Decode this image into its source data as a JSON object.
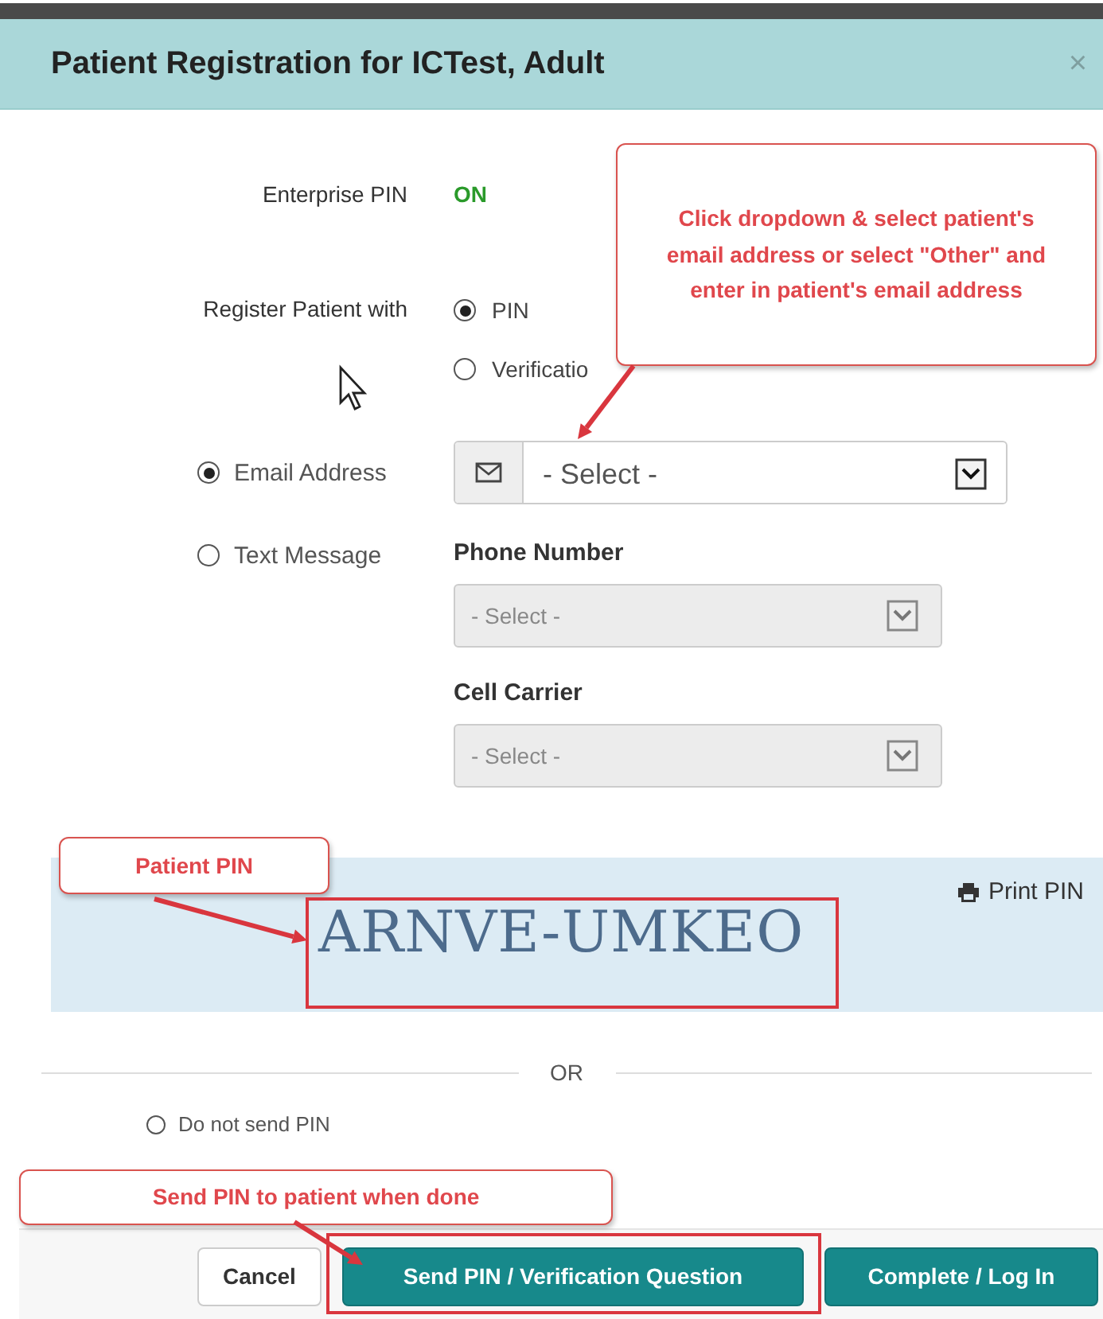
{
  "dialog": {
    "title": "Patient Registration for ICTest, Adult",
    "close": "×"
  },
  "enterprise_pin": {
    "label": "Enterprise PIN",
    "value": "ON"
  },
  "register_with": {
    "label": "Register Patient with",
    "options": [
      {
        "label": "PIN",
        "selected": true
      },
      {
        "label": "Verificatio",
        "selected": false
      }
    ]
  },
  "delivery": [
    {
      "kind": "email",
      "label": "Email Address",
      "selected": true,
      "dropdown": {
        "value": "- Select -",
        "disabled": false
      }
    },
    {
      "kind": "text",
      "label": "Text Message",
      "selected": false,
      "fields": [
        {
          "label": "Phone Number",
          "dropdown": {
            "value": "- Select -",
            "disabled": true
          }
        },
        {
          "label": "Cell Carrier",
          "dropdown": {
            "value": "- Select -",
            "disabled": true
          }
        }
      ]
    }
  ],
  "pin": {
    "value": "ARNVE-UMKEO",
    "print": "Print PIN"
  },
  "separator": "OR",
  "no_send": {
    "label": "Do not send PIN",
    "selected": false
  },
  "buttons": [
    {
      "label": "Cancel",
      "kind": "default"
    },
    {
      "label": "Send PIN / Verification Question",
      "kind": "primary"
    },
    {
      "label": "Complete / Log In",
      "kind": "primary"
    }
  ],
  "annotations": [
    {
      "text": "Click dropdown & select patient's email address or select \"Other\" and enter in patient's email address"
    },
    {
      "text": "Patient PIN"
    },
    {
      "text": "Send PIN to patient when done"
    }
  ]
}
